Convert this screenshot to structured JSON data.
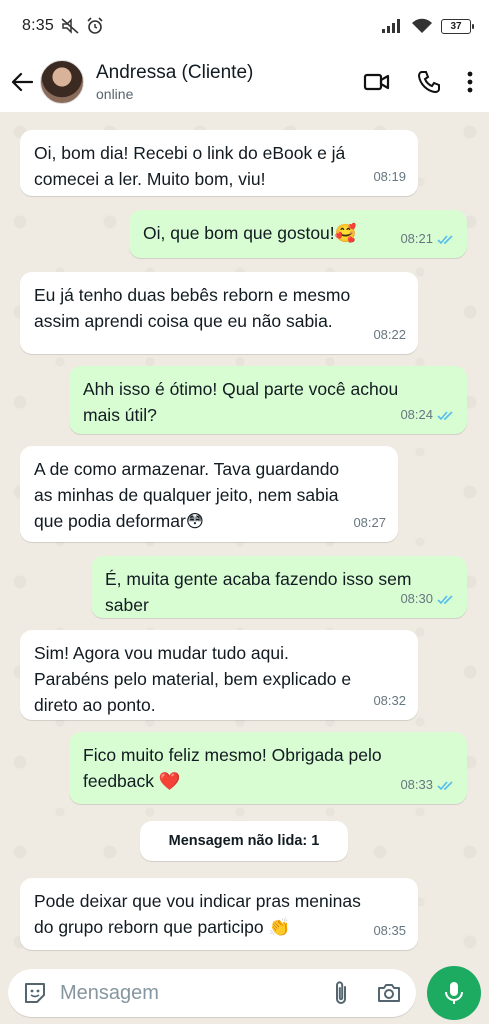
{
  "status_bar": {
    "time": "8:35",
    "battery": "37"
  },
  "header": {
    "name": "Andressa (Cliente)",
    "presence": "online"
  },
  "messages": [
    {
      "text_line1": "Oi, bom dia! Recebi o link do eBook e já",
      "text_line2": "comecei a ler. Muito bom, viu!",
      "time": "08:19"
    },
    {
      "text": "Oi, que bom que gostou!🥰",
      "time": "08:21"
    },
    {
      "text_line1": "Eu já tenho duas bebês reborn e mesmo",
      "text_line2": "assim aprendi coisa que eu não sabia.",
      "time": "08:22"
    },
    {
      "text_line1": "Ahh isso é ótimo! Qual parte você achou",
      "text_line2": "mais útil?",
      "time": "08:24"
    },
    {
      "text_line1": "A de como armazenar. Tava guardando",
      "text_line2": "as minhas de qualquer jeito, nem sabia",
      "text_line3": "que podia deformar😳",
      "time": "08:27"
    },
    {
      "text_line1": "É, muita gente acaba fazendo isso sem",
      "text_line2": "saber",
      "time": "08:30"
    },
    {
      "text_line1": "Sim! Agora vou mudar tudo aqui.",
      "text_line2": "Parabéns pelo material, bem explicado e",
      "text_line3": "direto ao ponto.",
      "time": "08:32"
    },
    {
      "text_line1": "Fico muito feliz mesmo! Obrigada pelo",
      "text_line2": "feedback ❤️",
      "time": "08:33"
    },
    {
      "text_line1": "Pode deixar que vou indicar pras meninas",
      "text_line2": "do grupo reborn que participo 👏",
      "time": "08:35"
    }
  ],
  "unread_label": "Mensagem não lida: 1",
  "composer": {
    "placeholder": "Mensagem"
  },
  "colors": {
    "accent": "#1daa61",
    "outgoing": "#d9fdd3",
    "incoming": "#ffffff",
    "read_ticks": "#53bdeb"
  }
}
